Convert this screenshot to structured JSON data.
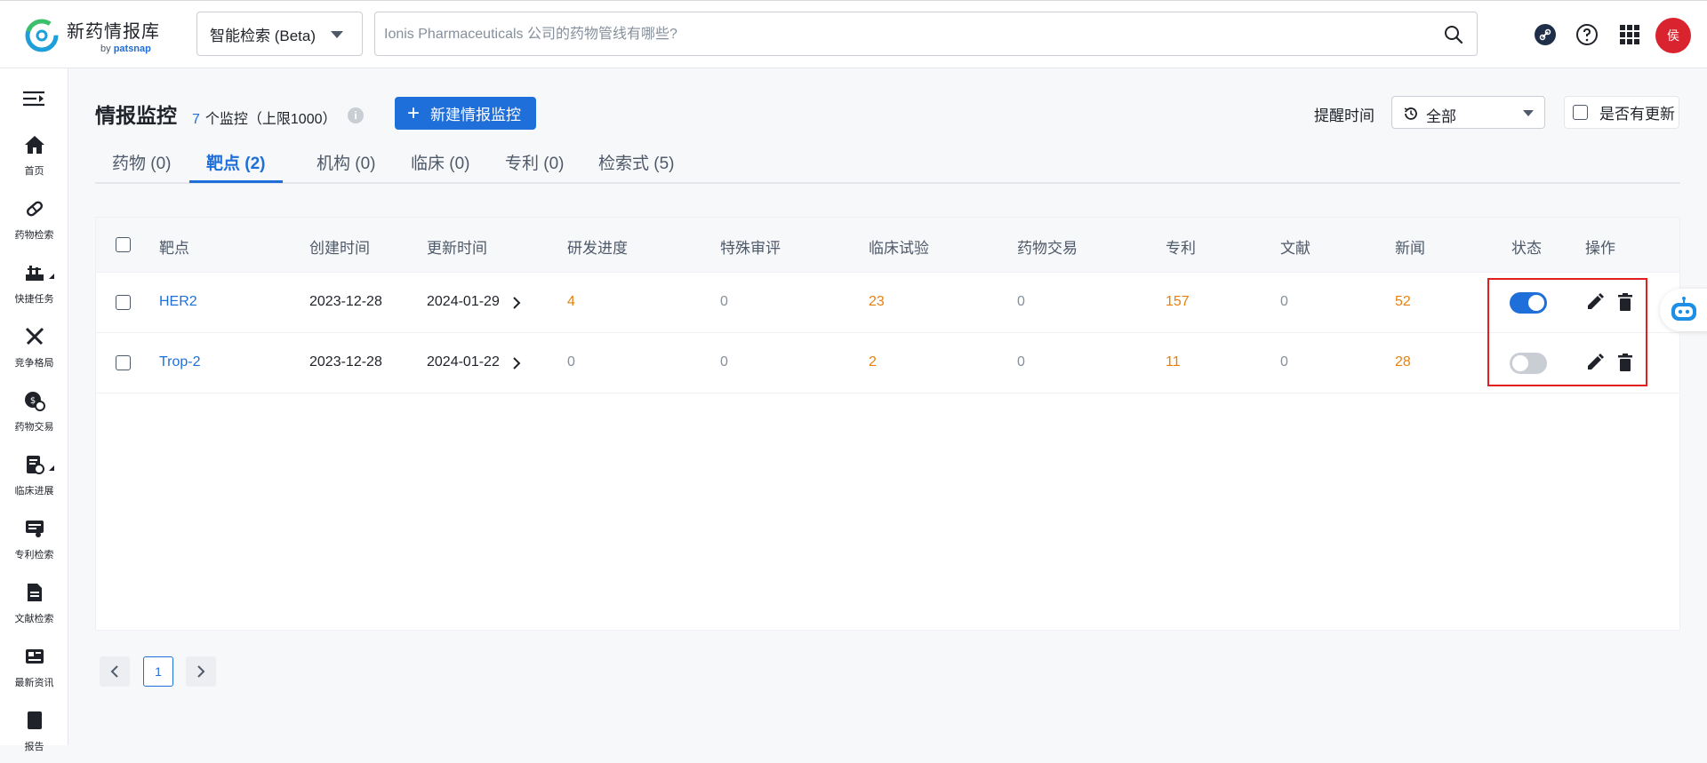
{
  "header": {
    "logo_title": "新药情报库",
    "logo_by": "by",
    "logo_brand": "patsnap",
    "mode_select": "智能检索 (Beta)",
    "search_placeholder": "Ionis Pharmaceuticals 公司的药物管线有哪些?",
    "avatar_text": "侯"
  },
  "sidebar": {
    "items": [
      {
        "label": "首页",
        "icon": "home-icon"
      },
      {
        "label": "药物检索",
        "icon": "pill-icon"
      },
      {
        "label": "快捷任务",
        "icon": "task-icon"
      },
      {
        "label": "竞争格局",
        "icon": "swords-icon"
      },
      {
        "label": "药物交易",
        "icon": "deal-icon"
      },
      {
        "label": "临床进展",
        "icon": "clinical-icon"
      },
      {
        "label": "专利检索",
        "icon": "patent-icon"
      },
      {
        "label": "文献检索",
        "icon": "document-icon"
      },
      {
        "label": "最新资讯",
        "icon": "news-icon"
      },
      {
        "label": "报告",
        "icon": "report-icon"
      }
    ]
  },
  "page": {
    "title": "情报监控",
    "count": "7",
    "count_text": "个监控（上限1000）",
    "new_button": "新建情报监控",
    "remind_label": "提醒时间",
    "remind_value": "全部",
    "update_label": "是否有更新"
  },
  "tabs": [
    {
      "label": "药物 (0)"
    },
    {
      "label": "靶点 (2)"
    },
    {
      "label": "机构 (0)"
    },
    {
      "label": "临床 (0)"
    },
    {
      "label": "专利 (0)"
    },
    {
      "label": "检索式 (5)"
    }
  ],
  "table": {
    "headers": [
      "靶点",
      "创建时间",
      "更新时间",
      "研发进度",
      "特殊审评",
      "临床试验",
      "药物交易",
      "专利",
      "文献",
      "新闻",
      "状态",
      "操作"
    ],
    "rows": [
      {
        "target": "HER2",
        "created": "2023-12-28",
        "updated": "2024-01-29",
        "progress": "4",
        "special": "0",
        "trials": "23",
        "deals": "0",
        "patents": "157",
        "literature": "0",
        "news": "52",
        "status": "on"
      },
      {
        "target": "Trop-2",
        "created": "2023-12-28",
        "updated": "2024-01-22",
        "progress": "0",
        "special": "0",
        "trials": "2",
        "deals": "0",
        "patents": "11",
        "literature": "0",
        "news": "28",
        "status": "off"
      }
    ]
  },
  "pagination": {
    "current": "1"
  },
  "colors": {
    "accent": "#1e6fd9",
    "orange": "#e8800f",
    "highlight": "#e02020"
  }
}
